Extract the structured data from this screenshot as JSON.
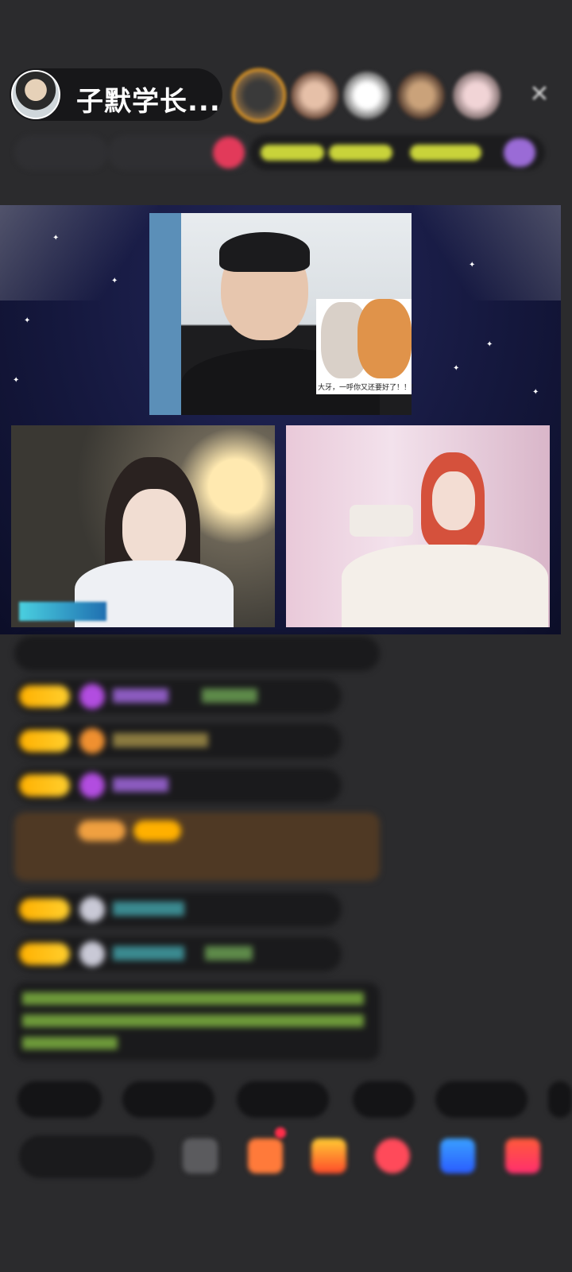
{
  "header": {
    "host_name": "子默学长...",
    "close_icon": "close-icon"
  },
  "stage": {
    "main_video": {
      "cat_caption": "大牙，一呼你又还要好了！！！"
    }
  },
  "colors": {
    "background": "#2b2b2d",
    "stage": "#15183e",
    "badge": "#ffb000"
  }
}
